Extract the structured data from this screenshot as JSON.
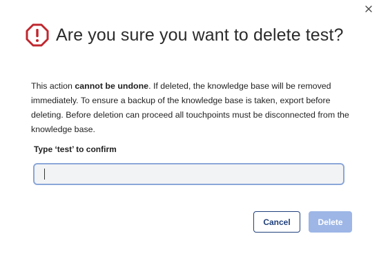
{
  "dialog": {
    "title": "Are you sure you want to delete test?",
    "body": {
      "part1": "This action ",
      "bold": "cannot be undone",
      "part2": ". If deleted, the knowledge base will be removed immediately. To ensure a backup of the knowledge base is taken, export before deleting. Before deletion can proceed all touchpoints must be disconnected from the knowledge base."
    },
    "confirm_label": "Type ‘test’ to confirm",
    "input_value": "",
    "cancel_label": "Cancel",
    "delete_label": "Delete"
  },
  "icons": {
    "warning": "warning-octagon-icon",
    "close": "close-icon"
  },
  "colors": {
    "warning_red": "#c0262d",
    "primary_navy": "#1f3f7a",
    "delete_disabled": "#9db6e6",
    "input_border": "#8aa6d8"
  }
}
